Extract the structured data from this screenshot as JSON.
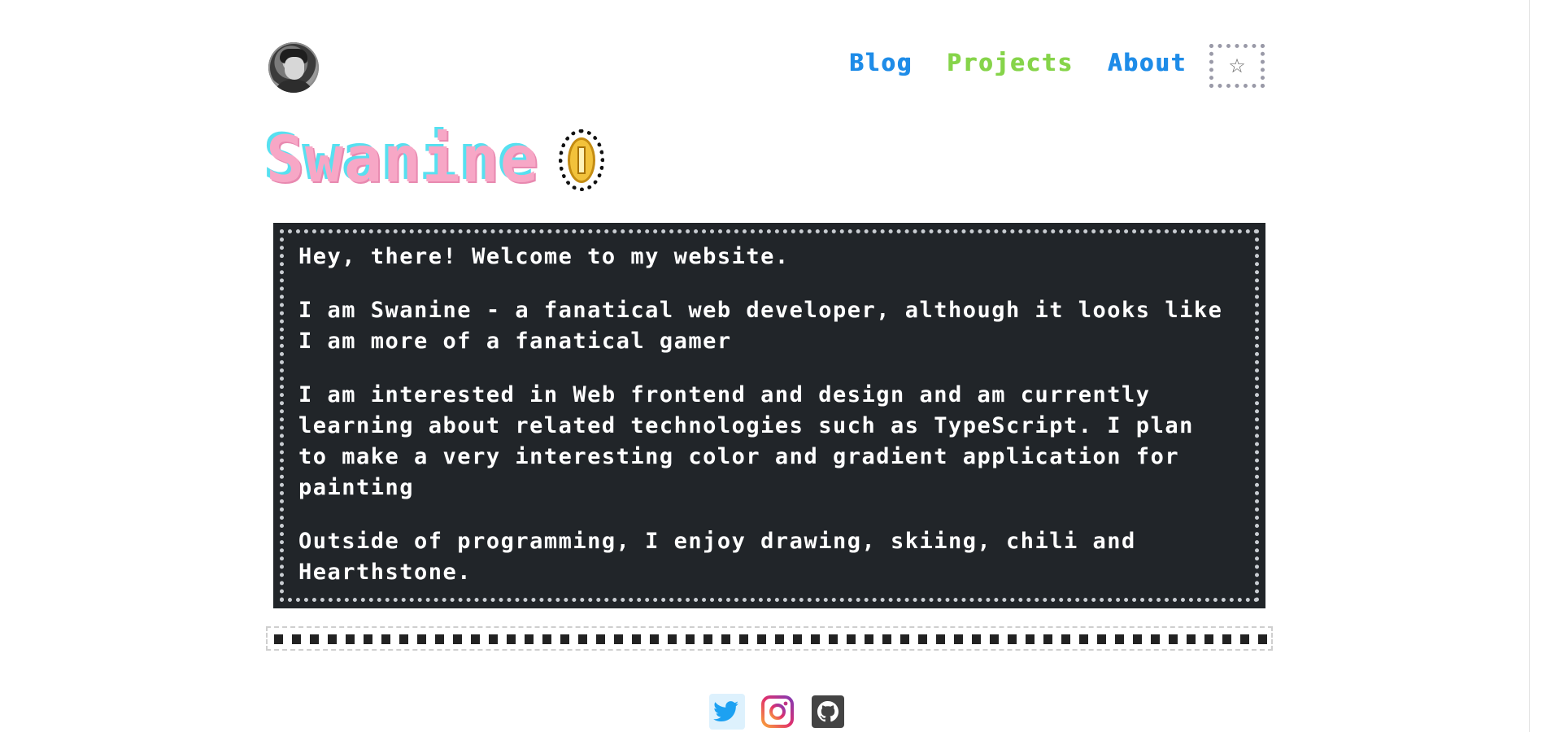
{
  "header": {
    "avatar_icon": "avatar-photo",
    "nav": {
      "blog": "Blog",
      "projects": "Projects",
      "about": "About"
    },
    "theme_toggle_icon": "star-icon",
    "colors": {
      "blog": "#1e8ce8",
      "projects": "#86d44a",
      "about": "#1e8ce8"
    }
  },
  "hero": {
    "title": "Swanine",
    "title_color": "#f7a7c6",
    "title_shadow": "#57e0f0",
    "badge_icon": "coin-icon"
  },
  "intro": {
    "paragraphs": [
      "Hey, there! Welcome to my website.",
      "I am Swanine - a fanatical web developer, although it looks like I am more of a fanatical gamer",
      "I am interested in Web frontend and design and am currently learning about related technologies such as TypeScript. I plan to make a very interesting color and gradient application for painting",
      "Outside of programming, I enjoy drawing, skiing, chili and Hearthstone."
    ],
    "background": "#212529"
  },
  "footer": {
    "social": [
      {
        "icon": "twitter-icon",
        "color": "#1da1f2"
      },
      {
        "icon": "instagram-icon",
        "color": "#c13584"
      },
      {
        "icon": "github-icon",
        "color": "#444444"
      }
    ]
  }
}
